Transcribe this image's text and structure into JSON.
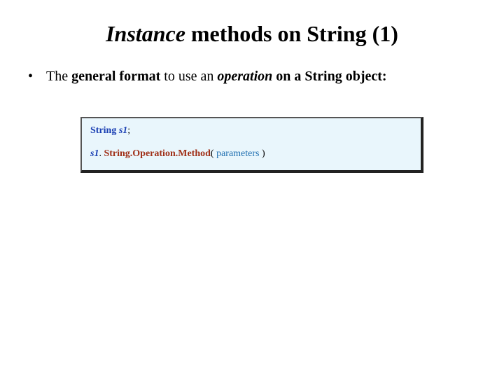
{
  "title": {
    "word_instance": "Instance",
    "rest": " methods on String (1)"
  },
  "bullet": {
    "marker": "•",
    "prefix": "The ",
    "bold1": "general format",
    "mid": " to use an ",
    "italic_bold": "operation",
    "suffix": " on a String object:"
  },
  "code": {
    "l1_kw": "String",
    "l1_var": "s1",
    "l1_semi": ";",
    "l2_var": "s1",
    "l2_dot1": ". ",
    "l2_method": "String.Operation.Method",
    "l2_open": "( ",
    "l2_params": "parameters",
    "l2_close": " )"
  }
}
